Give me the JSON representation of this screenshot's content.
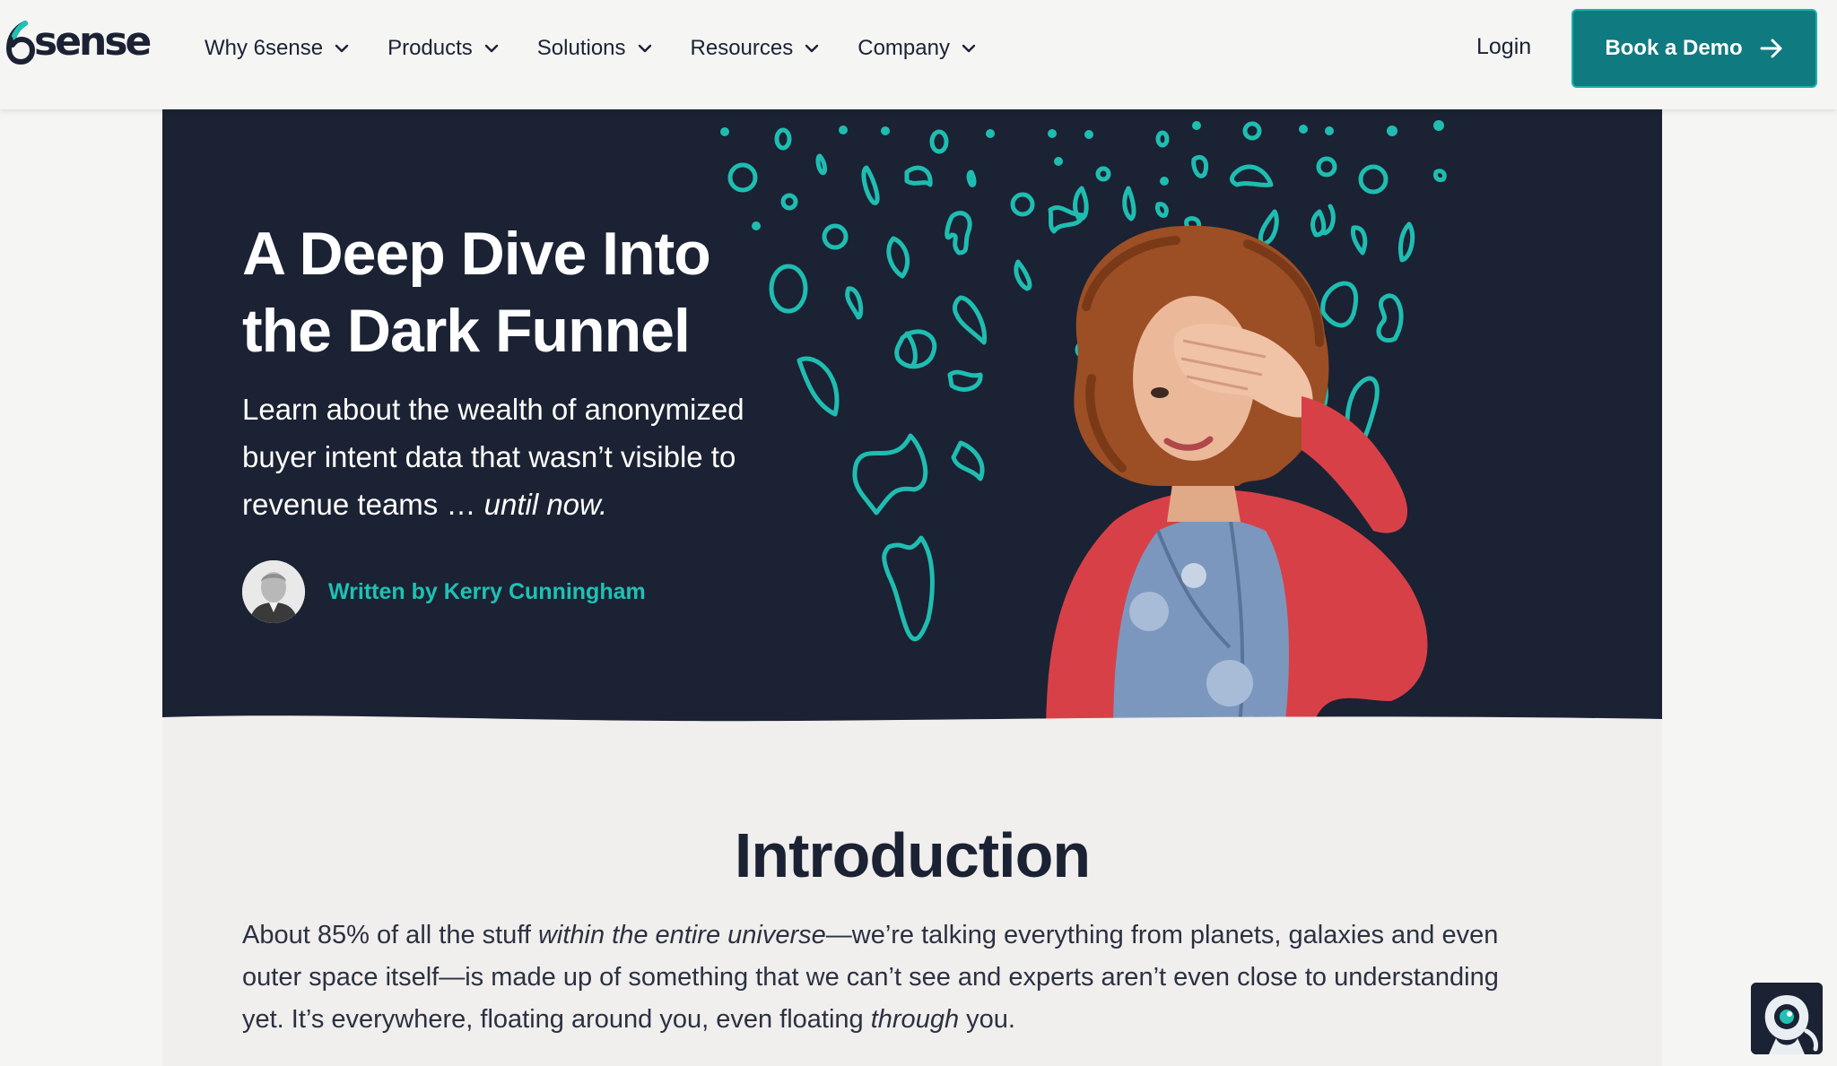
{
  "header": {
    "logo_text": "sense",
    "nav": [
      {
        "label": "Why 6sense"
      },
      {
        "label": "Products"
      },
      {
        "label": "Solutions"
      },
      {
        "label": "Resources"
      },
      {
        "label": "Company"
      }
    ],
    "login_label": "Login",
    "cta_label": "Book a Demo"
  },
  "hero": {
    "title_line1": "A Deep Dive Into",
    "title_line2": "the Dark Funnel",
    "subtitle_main": "Learn about the wealth of anonymized buyer intent data that wasn’t visible to revenue teams … ",
    "subtitle_emphasis": "until now.",
    "author_link": "Written by Kerry Cunningham"
  },
  "content": {
    "heading": "Introduction",
    "p1_a": "About 85% of all the stuff ",
    "p1_em1": "within the entire universe",
    "p1_b": "—we’re talking everything from planets, galaxies and even outer space itself—is made up of something that we can’t see and experts aren’t even close to understanding yet. It’s everywhere, floating around you, even floating ",
    "p1_em2": "through",
    "p1_c": " you."
  },
  "colors": {
    "navy": "#1b2233",
    "teal_button": "#0f7a80",
    "teal_accent": "#1fc1b4",
    "page_bg": "#f5f5f4",
    "content_bg": "#f1efed"
  },
  "icons": {
    "logo": "6sense-logo-icon",
    "nav_chevron": "chevron-down-icon",
    "cta_arrow": "arrow-right-icon",
    "chat": "chat-robot-icon"
  }
}
